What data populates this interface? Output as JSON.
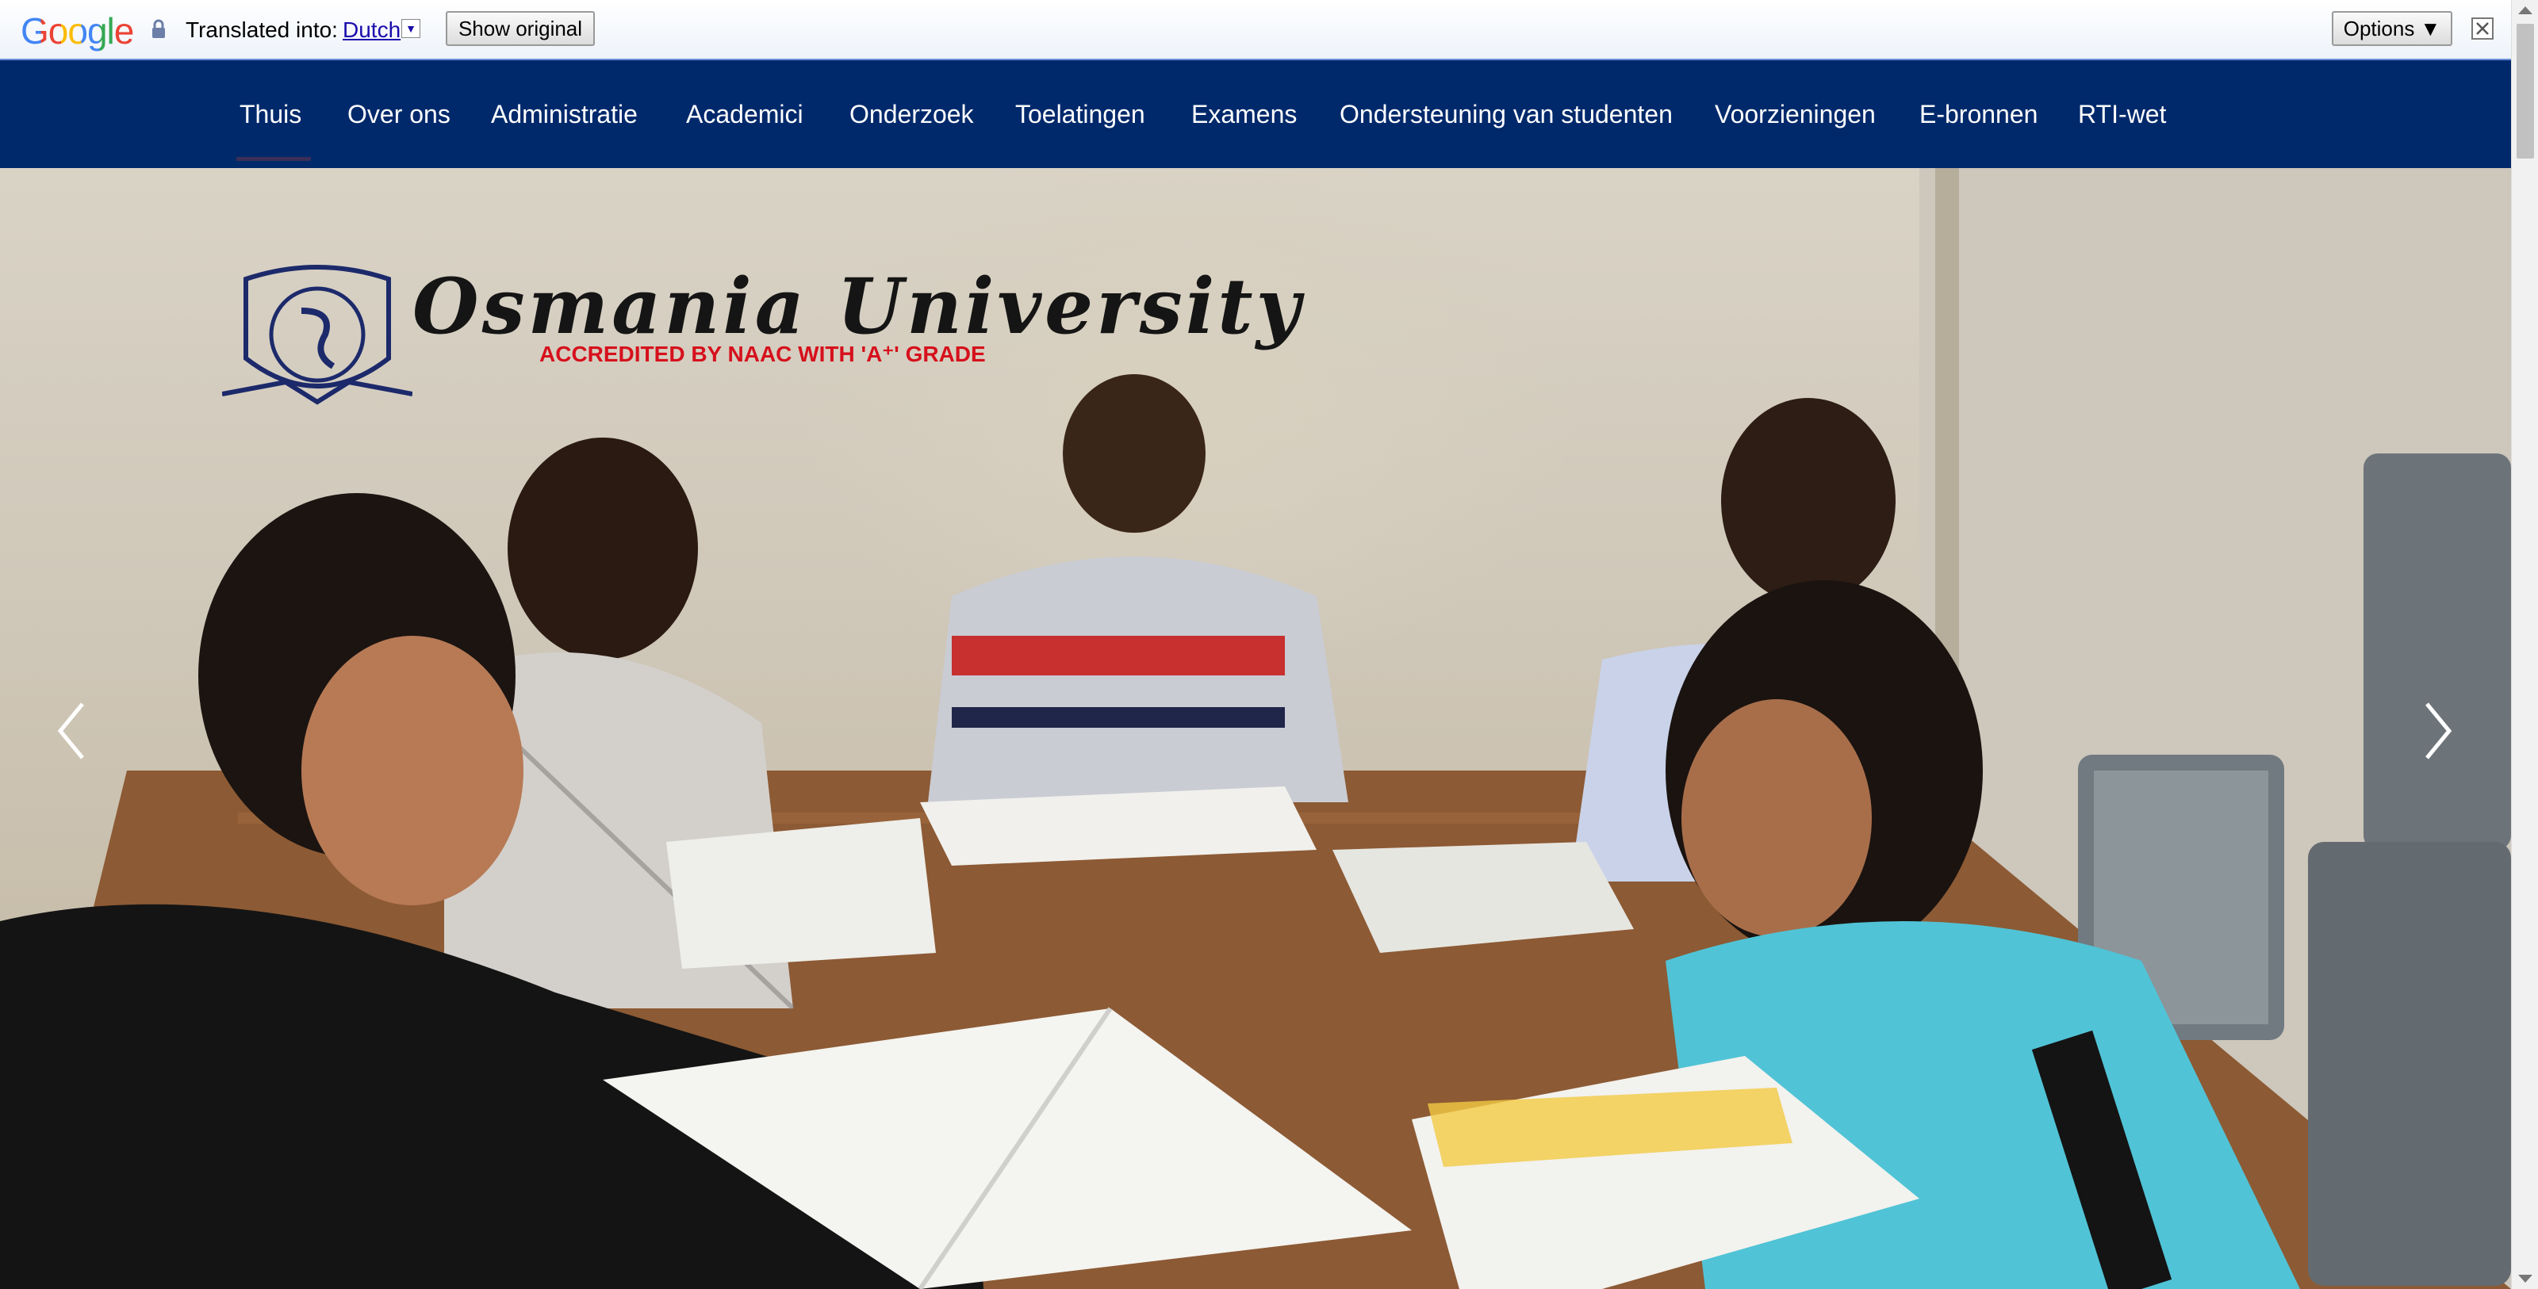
{
  "translate_bar": {
    "brand": "Google",
    "translated_label": "Translated into:",
    "language": "Dutch",
    "show_original_label": "Show original",
    "options_label": "Options ▼"
  },
  "nav": {
    "items": [
      {
        "label": "Thuis"
      },
      {
        "label": "Over ons"
      },
      {
        "label": "Administratie"
      },
      {
        "label": "Academici"
      },
      {
        "label": "Onderzoek"
      },
      {
        "label": "Toelatingen"
      },
      {
        "label": "Examens"
      },
      {
        "label": "Ondersteuning van studenten"
      },
      {
        "label": "Voorzieningen"
      },
      {
        "label": "E-bronnen"
      },
      {
        "label": "RTI-wet"
      }
    ],
    "active_index": 0
  },
  "hero": {
    "logo_title": "Osmania University",
    "logo_subtitle": "ACCREDITED BY NAAC WITH 'A⁺' GRADE",
    "prev_icon": "chevron-left-icon",
    "next_icon": "chevron-right-icon"
  },
  "colors": {
    "nav_bg": "#00296b",
    "accent_red": "#d6101c"
  }
}
